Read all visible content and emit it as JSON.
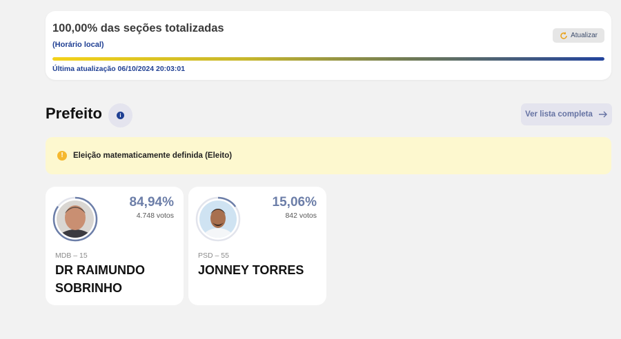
{
  "status": {
    "title": "100,00% das seções totalizadas",
    "subtitle": "(Horário local)",
    "refresh_label": "Atualizar",
    "progress_percent": 100,
    "last_update": "Última atualização 06/10/2024 20:03:01"
  },
  "section": {
    "title": "Prefeito",
    "full_list_label": "Ver lista completa"
  },
  "notice": {
    "text": "Eleição matematicamente definida (Eleito)"
  },
  "candidates": [
    {
      "percent_label": "84,94%",
      "percent_value": 84.94,
      "votes": "4.748 votos",
      "party": "MDB – 15",
      "name": "DR RAIMUNDO SOBRINHO"
    },
    {
      "percent_label": "15,06%",
      "percent_value": 15.06,
      "votes": "842 votos",
      "party": "PSD – 55",
      "name": "JONNEY TORRES"
    }
  ],
  "colors": {
    "accent": "#1f3f93",
    "percent": "#6c7ea8",
    "notice_bg": "#fdf8cf",
    "warn": "#f5b82e"
  },
  "icons": {
    "refresh": "refresh-icon",
    "info": "info-icon",
    "arrow": "arrow-right-icon",
    "warning": "warning-icon"
  }
}
